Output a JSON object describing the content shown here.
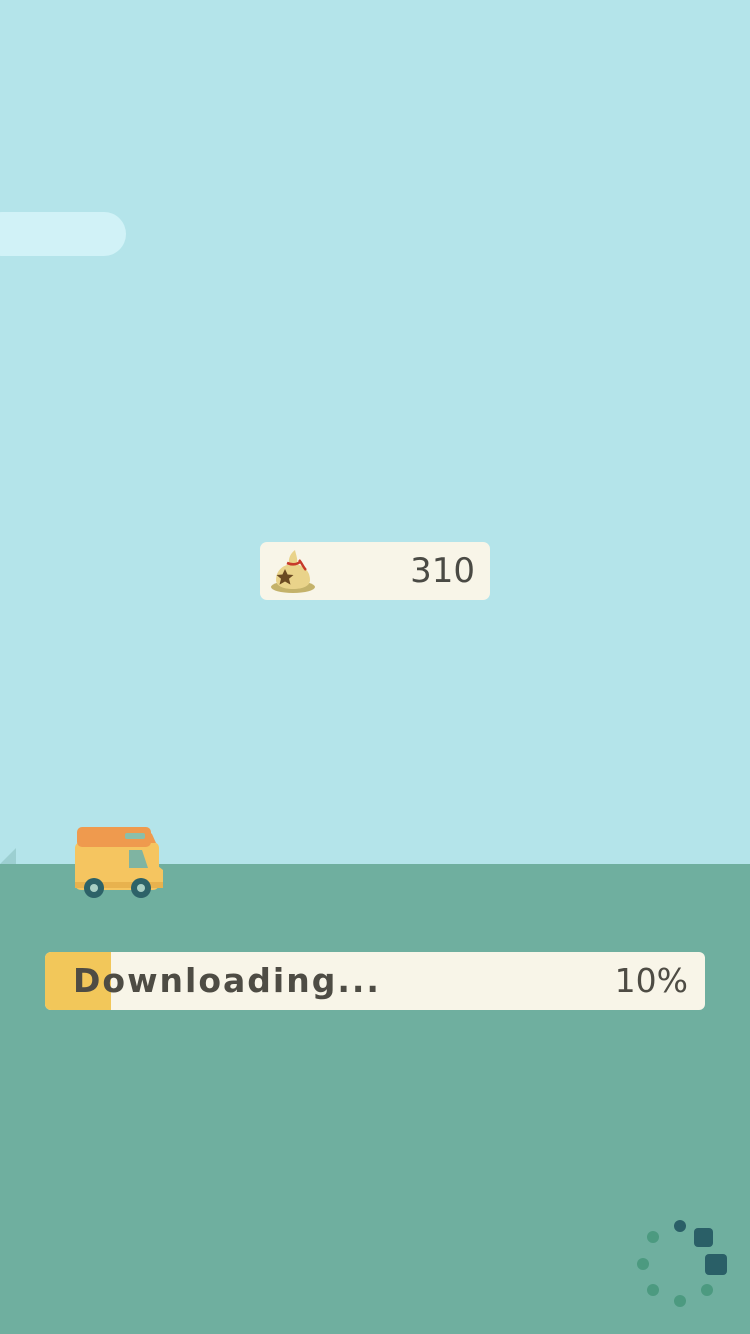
{
  "wallet": {
    "currency_icon": "bell-bag-icon",
    "bells": "310"
  },
  "vehicle": {
    "icon": "camper-van-icon"
  },
  "download": {
    "label": "Downloading...",
    "progress": 0.1,
    "percent_text": "10%"
  },
  "loading_indicator": {
    "icon": "loading-spinner-icon"
  },
  "colors": {
    "sky": "#b4e4ea",
    "cloud": "#d1f2f7",
    "ground": "#6faf9f",
    "panel": "#f8f5e8",
    "progress_fill": "#f2c75a",
    "text": "#4e4c44",
    "spinner_dark": "#2a5f67",
    "spinner_light": "#4c9a80"
  }
}
